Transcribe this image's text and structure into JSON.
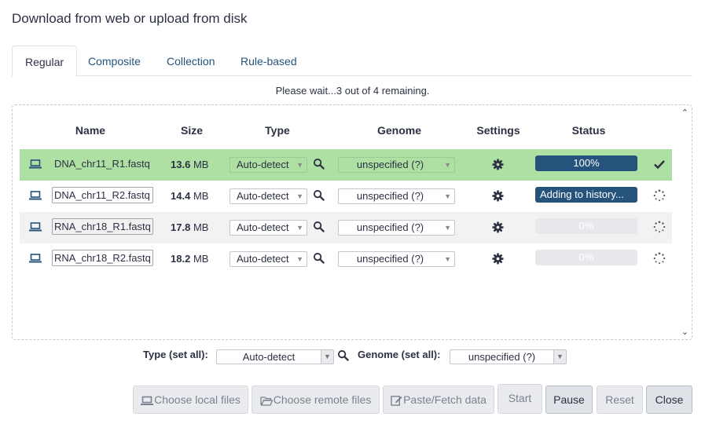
{
  "dialog": {
    "title": "Download from web or upload from disk"
  },
  "tabs": [
    {
      "label": "Regular"
    },
    {
      "label": "Composite"
    },
    {
      "label": "Collection"
    },
    {
      "label": "Rule-based"
    }
  ],
  "status_message": "Please wait...3 out of 4 remaining.",
  "table": {
    "headers": {
      "name": "Name",
      "size": "Size",
      "type": "Type",
      "genome": "Genome",
      "settings": "Settings",
      "status": "Status"
    },
    "rows": [
      {
        "name": "DNA_chr11_R1.fastq",
        "size_value": "13.6",
        "size_unit": "MB",
        "type": "Auto-detect",
        "genome": "unspecified (?)",
        "status_text": "100%",
        "progress": 100,
        "status_icon": "check-icon"
      },
      {
        "name": "DNA_chr11_R2.fastq",
        "size_value": "14.4",
        "size_unit": "MB",
        "type": "Auto-detect",
        "genome": "unspecified (?)",
        "status_text": "Adding to history...",
        "progress": 100,
        "status_icon": "spinner-icon"
      },
      {
        "name": "RNA_chr18_R1.fastq",
        "size_value": "17.8",
        "size_unit": "MB",
        "type": "Auto-detect",
        "genome": "unspecified (?)",
        "status_text": "0%",
        "progress": 0,
        "status_icon": "spinner-icon"
      },
      {
        "name": "RNA_chr18_R2.fastq",
        "size_value": "18.2",
        "size_unit": "MB",
        "type": "Auto-detect",
        "genome": "unspecified (?)",
        "status_text": "0%",
        "progress": 0,
        "status_icon": "spinner-icon"
      }
    ]
  },
  "set_all": {
    "type_label": "Type (set all):",
    "type_value": "Auto-detect",
    "genome_label": "Genome (set all):",
    "genome_value": "unspecified (?)"
  },
  "buttons": {
    "choose_local": "Choose local files",
    "choose_remote": "Choose remote files",
    "paste_fetch": "Paste/Fetch data",
    "start": "Start",
    "pause": "Pause",
    "reset": "Reset",
    "close": "Close"
  },
  "colors": {
    "primary": "#25537b",
    "success_row": "#aee0a3",
    "progress_track": "#e6e8ec",
    "text": "#2c3143"
  }
}
